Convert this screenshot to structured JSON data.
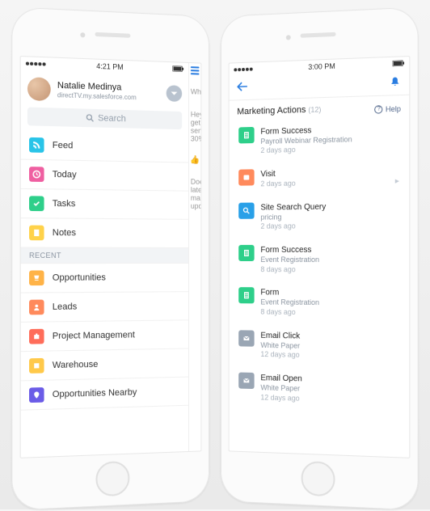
{
  "left": {
    "status": {
      "time": "4:21 PM"
    },
    "user": {
      "name": "Natalie Medinya",
      "org": "directTV.my.salesforce.com"
    },
    "search": {
      "placeholder": "Search"
    },
    "menu": [
      {
        "icon": "feed",
        "color": "#29c4e8",
        "label": "Feed"
      },
      {
        "icon": "today",
        "color": "#ef5fa1",
        "label": "Today"
      },
      {
        "icon": "tasks",
        "color": "#2ecf8a",
        "label": "Tasks"
      },
      {
        "icon": "notes",
        "color": "#ffd24a",
        "label": "Notes"
      }
    ],
    "recent_header": "RECENT",
    "recent": [
      {
        "icon": "opps",
        "color": "#ffb347",
        "label": "Opportunities"
      },
      {
        "icon": "leads",
        "color": "#ff8a5c",
        "label": "Leads"
      },
      {
        "icon": "proj",
        "color": "#ff6d5a",
        "label": "Project Management"
      },
      {
        "icon": "wh",
        "color": "#ffc94a",
        "label": "Warehouse"
      },
      {
        "icon": "near",
        "color": "#6b5ce7",
        "label": "Opportunities Nearby"
      }
    ],
    "peek": {
      "wha": "Wha",
      "card1": [
        "Hey",
        "get",
        "sen",
        "30%"
      ],
      "card2": [
        "Doe",
        "late",
        "ma",
        "upd"
      ]
    }
  },
  "right": {
    "status": {
      "time": "3:00 PM"
    },
    "section": {
      "title": "Marketing Actions",
      "count": "(12)",
      "help": "Help"
    },
    "actions": [
      {
        "icon": "form",
        "color": "#2ecf8a",
        "l1": "Form Success",
        "l2": "Payroll Webinar Registration",
        "l3": "2 days ago"
      },
      {
        "icon": "visit",
        "color": "#ff8a5c",
        "l1": "Visit",
        "l2": "",
        "l3": "2 days ago",
        "chevron": true
      },
      {
        "icon": "search",
        "color": "#29a0e8",
        "l1": "Site Search Query",
        "l2": "pricing",
        "l3": "2 days ago"
      },
      {
        "icon": "form",
        "color": "#2ecf8a",
        "l1": "Form Success",
        "l2": "Event Registration",
        "l3": "8 days ago"
      },
      {
        "icon": "form",
        "color": "#2ecf8a",
        "l1": "Form",
        "l2": "Event Registration",
        "l3": "8 days ago"
      },
      {
        "icon": "mail",
        "color": "#9aa6b4",
        "l1": "Email Click",
        "l2": "White Paper",
        "l3": "12 days ago"
      },
      {
        "icon": "mail",
        "color": "#9aa6b4",
        "l1": "Email Open",
        "l2": "White Paper",
        "l3": "12 days ago"
      }
    ]
  }
}
